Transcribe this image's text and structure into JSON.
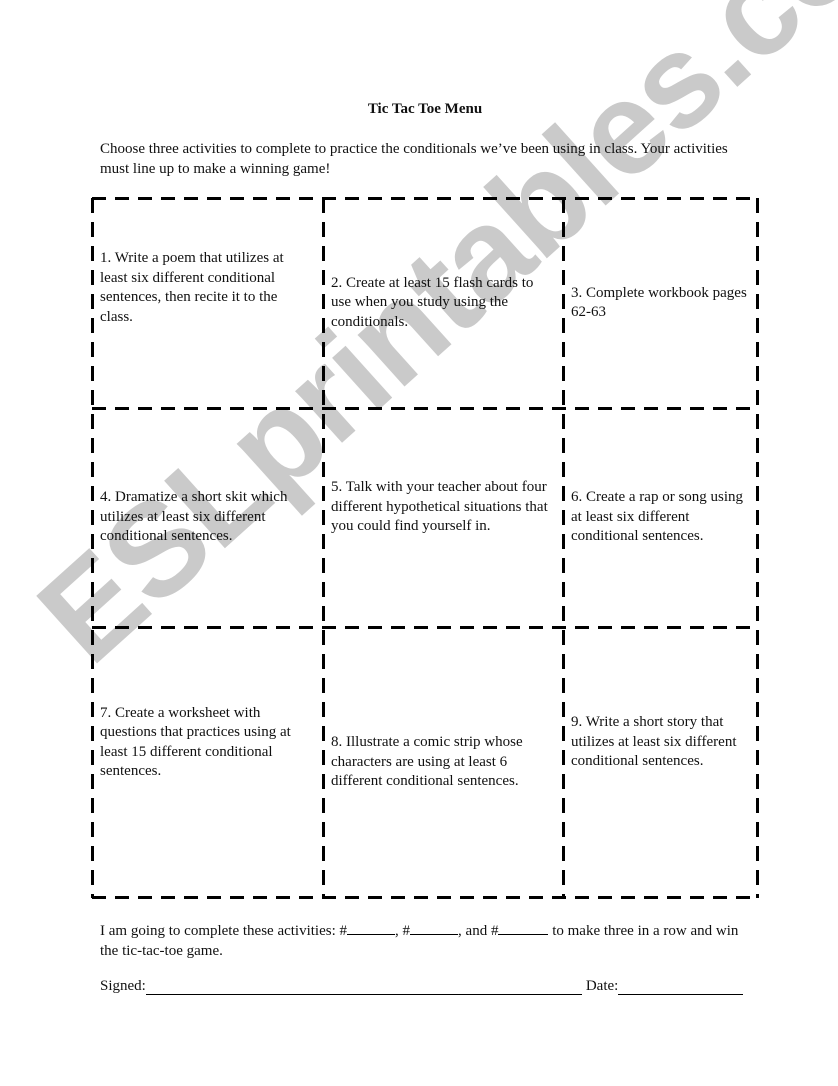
{
  "document": {
    "title": "Tic Tac Toe Menu",
    "intro": "Choose three activities to complete to practice the conditionals we’ve been using in class. Your activities must line up to make a winning game!",
    "cells": [
      "1. Write a poem that utilizes at least six different conditional sentences, then recite it to the class.",
      "2. Create at least 15 flash cards to use when you study using the conditionals.",
      "3. Complete workbook pages 62-63",
      "4. Dramatize a short skit which utilizes at least six different conditional sentences.",
      "5. Talk with your teacher about four different hypothetical situations that you could find yourself in.",
      "6. Create a rap or song using at least six different conditional sentences.",
      "7. Create a worksheet with questions that practices using at least 15 different conditional sentences.",
      "8. Illustrate a comic strip whose characters are using at least 6 different conditional sentences.",
      "9. Write a short story that utilizes at least six different conditional sentences."
    ],
    "footer": {
      "part1": "I am going to complete these activities: #",
      "part2": ", #",
      "part3": ", and #",
      "part4": " to make three in a row and win the tic-tac-toe game.",
      "signed_label": "Signed:",
      "date_label": "Date:"
    },
    "watermark": "ESLprintables.com"
  }
}
